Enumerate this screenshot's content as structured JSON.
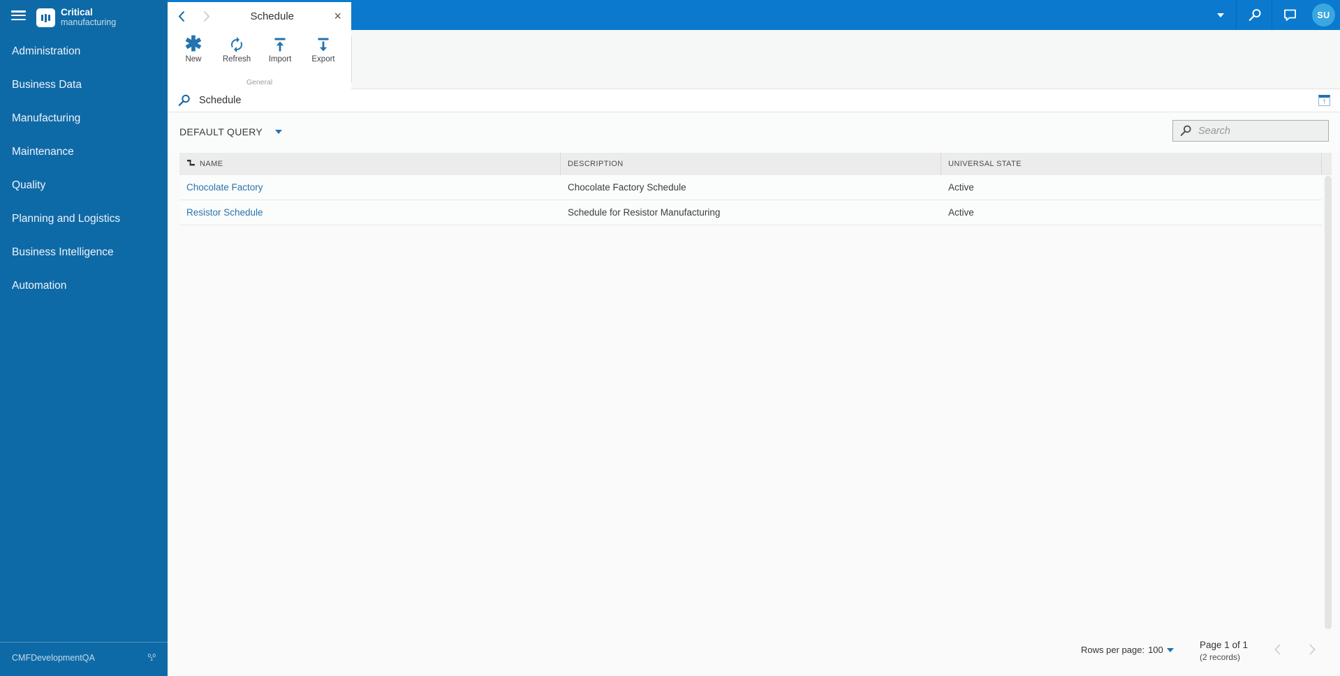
{
  "colors": {
    "sidebar_bg": "#0e6aa7",
    "topbar_bg": "#0b7ace",
    "accent_blue": "#2273ae",
    "link_blue": "#2a73ae",
    "avatar_bg": "#3aa7e0",
    "grid_header_bg": "#ececec"
  },
  "icons": {
    "close": "×",
    "asterisk": "✱",
    "up_arrow": "↑",
    "binary": "⁰₁⁰"
  },
  "brand": {
    "line1": "Critical",
    "line2": "manufacturing"
  },
  "sidebar": {
    "items": [
      "Administration",
      "Business Data",
      "Manufacturing",
      "Maintenance",
      "Quality",
      "Planning and Logistics",
      "Business Intelligence",
      "Automation"
    ],
    "environment": "CMFDevelopmentQA"
  },
  "topbar": {
    "avatar_initials": "SU"
  },
  "tab": {
    "title": "Schedule"
  },
  "toolbar": {
    "group_label": "General",
    "buttons": [
      {
        "label": "New"
      },
      {
        "label": "Refresh"
      },
      {
        "label": "Import"
      },
      {
        "label": "Export"
      }
    ]
  },
  "filter": {
    "entity": "Schedule"
  },
  "query": {
    "selected": "DEFAULT QUERY"
  },
  "search": {
    "placeholder": "Search"
  },
  "table": {
    "columns": [
      "NAME",
      "DESCRIPTION",
      "UNIVERSAL STATE"
    ],
    "rows": [
      {
        "name": "Chocolate Factory",
        "description": "Chocolate Factory Schedule",
        "state": "Active"
      },
      {
        "name": "Resistor Schedule",
        "description": "Schedule for Resistor Manufacturing",
        "state": "Active"
      }
    ]
  },
  "pagination": {
    "rows_per_page_label": "Rows per page:",
    "rows_per_page_value": "100",
    "page_label": "Page 1 of 1",
    "records_label": "(2 records)"
  }
}
